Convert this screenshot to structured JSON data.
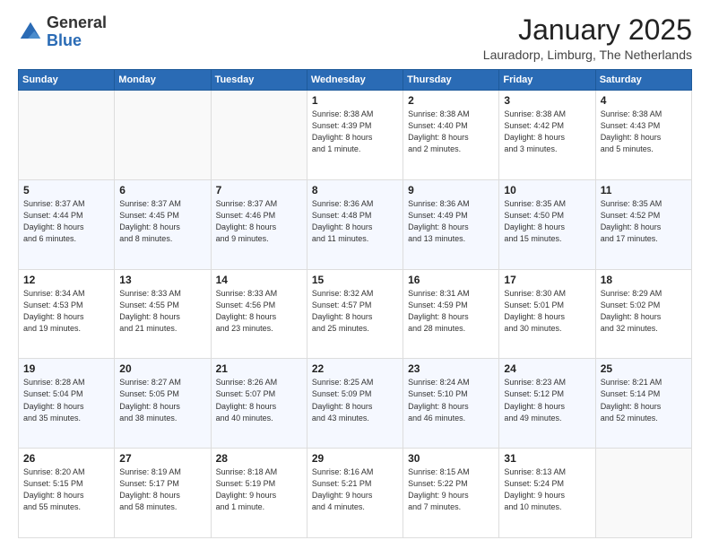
{
  "logo": {
    "general": "General",
    "blue": "Blue"
  },
  "header": {
    "month": "January 2025",
    "location": "Lauradorp, Limburg, The Netherlands"
  },
  "days_of_week": [
    "Sunday",
    "Monday",
    "Tuesday",
    "Wednesday",
    "Thursday",
    "Friday",
    "Saturday"
  ],
  "weeks": [
    [
      {
        "day": "",
        "info": ""
      },
      {
        "day": "",
        "info": ""
      },
      {
        "day": "",
        "info": ""
      },
      {
        "day": "1",
        "info": "Sunrise: 8:38 AM\nSunset: 4:39 PM\nDaylight: 8 hours\nand 1 minute."
      },
      {
        "day": "2",
        "info": "Sunrise: 8:38 AM\nSunset: 4:40 PM\nDaylight: 8 hours\nand 2 minutes."
      },
      {
        "day": "3",
        "info": "Sunrise: 8:38 AM\nSunset: 4:42 PM\nDaylight: 8 hours\nand 3 minutes."
      },
      {
        "day": "4",
        "info": "Sunrise: 8:38 AM\nSunset: 4:43 PM\nDaylight: 8 hours\nand 5 minutes."
      }
    ],
    [
      {
        "day": "5",
        "info": "Sunrise: 8:37 AM\nSunset: 4:44 PM\nDaylight: 8 hours\nand 6 minutes."
      },
      {
        "day": "6",
        "info": "Sunrise: 8:37 AM\nSunset: 4:45 PM\nDaylight: 8 hours\nand 8 minutes."
      },
      {
        "day": "7",
        "info": "Sunrise: 8:37 AM\nSunset: 4:46 PM\nDaylight: 8 hours\nand 9 minutes."
      },
      {
        "day": "8",
        "info": "Sunrise: 8:36 AM\nSunset: 4:48 PM\nDaylight: 8 hours\nand 11 minutes."
      },
      {
        "day": "9",
        "info": "Sunrise: 8:36 AM\nSunset: 4:49 PM\nDaylight: 8 hours\nand 13 minutes."
      },
      {
        "day": "10",
        "info": "Sunrise: 8:35 AM\nSunset: 4:50 PM\nDaylight: 8 hours\nand 15 minutes."
      },
      {
        "day": "11",
        "info": "Sunrise: 8:35 AM\nSunset: 4:52 PM\nDaylight: 8 hours\nand 17 minutes."
      }
    ],
    [
      {
        "day": "12",
        "info": "Sunrise: 8:34 AM\nSunset: 4:53 PM\nDaylight: 8 hours\nand 19 minutes."
      },
      {
        "day": "13",
        "info": "Sunrise: 8:33 AM\nSunset: 4:55 PM\nDaylight: 8 hours\nand 21 minutes."
      },
      {
        "day": "14",
        "info": "Sunrise: 8:33 AM\nSunset: 4:56 PM\nDaylight: 8 hours\nand 23 minutes."
      },
      {
        "day": "15",
        "info": "Sunrise: 8:32 AM\nSunset: 4:57 PM\nDaylight: 8 hours\nand 25 minutes."
      },
      {
        "day": "16",
        "info": "Sunrise: 8:31 AM\nSunset: 4:59 PM\nDaylight: 8 hours\nand 28 minutes."
      },
      {
        "day": "17",
        "info": "Sunrise: 8:30 AM\nSunset: 5:01 PM\nDaylight: 8 hours\nand 30 minutes."
      },
      {
        "day": "18",
        "info": "Sunrise: 8:29 AM\nSunset: 5:02 PM\nDaylight: 8 hours\nand 32 minutes."
      }
    ],
    [
      {
        "day": "19",
        "info": "Sunrise: 8:28 AM\nSunset: 5:04 PM\nDaylight: 8 hours\nand 35 minutes."
      },
      {
        "day": "20",
        "info": "Sunrise: 8:27 AM\nSunset: 5:05 PM\nDaylight: 8 hours\nand 38 minutes."
      },
      {
        "day": "21",
        "info": "Sunrise: 8:26 AM\nSunset: 5:07 PM\nDaylight: 8 hours\nand 40 minutes."
      },
      {
        "day": "22",
        "info": "Sunrise: 8:25 AM\nSunset: 5:09 PM\nDaylight: 8 hours\nand 43 minutes."
      },
      {
        "day": "23",
        "info": "Sunrise: 8:24 AM\nSunset: 5:10 PM\nDaylight: 8 hours\nand 46 minutes."
      },
      {
        "day": "24",
        "info": "Sunrise: 8:23 AM\nSunset: 5:12 PM\nDaylight: 8 hours\nand 49 minutes."
      },
      {
        "day": "25",
        "info": "Sunrise: 8:21 AM\nSunset: 5:14 PM\nDaylight: 8 hours\nand 52 minutes."
      }
    ],
    [
      {
        "day": "26",
        "info": "Sunrise: 8:20 AM\nSunset: 5:15 PM\nDaylight: 8 hours\nand 55 minutes."
      },
      {
        "day": "27",
        "info": "Sunrise: 8:19 AM\nSunset: 5:17 PM\nDaylight: 8 hours\nand 58 minutes."
      },
      {
        "day": "28",
        "info": "Sunrise: 8:18 AM\nSunset: 5:19 PM\nDaylight: 9 hours\nand 1 minute."
      },
      {
        "day": "29",
        "info": "Sunrise: 8:16 AM\nSunset: 5:21 PM\nDaylight: 9 hours\nand 4 minutes."
      },
      {
        "day": "30",
        "info": "Sunrise: 8:15 AM\nSunset: 5:22 PM\nDaylight: 9 hours\nand 7 minutes."
      },
      {
        "day": "31",
        "info": "Sunrise: 8:13 AM\nSunset: 5:24 PM\nDaylight: 9 hours\nand 10 minutes."
      },
      {
        "day": "",
        "info": ""
      }
    ]
  ]
}
